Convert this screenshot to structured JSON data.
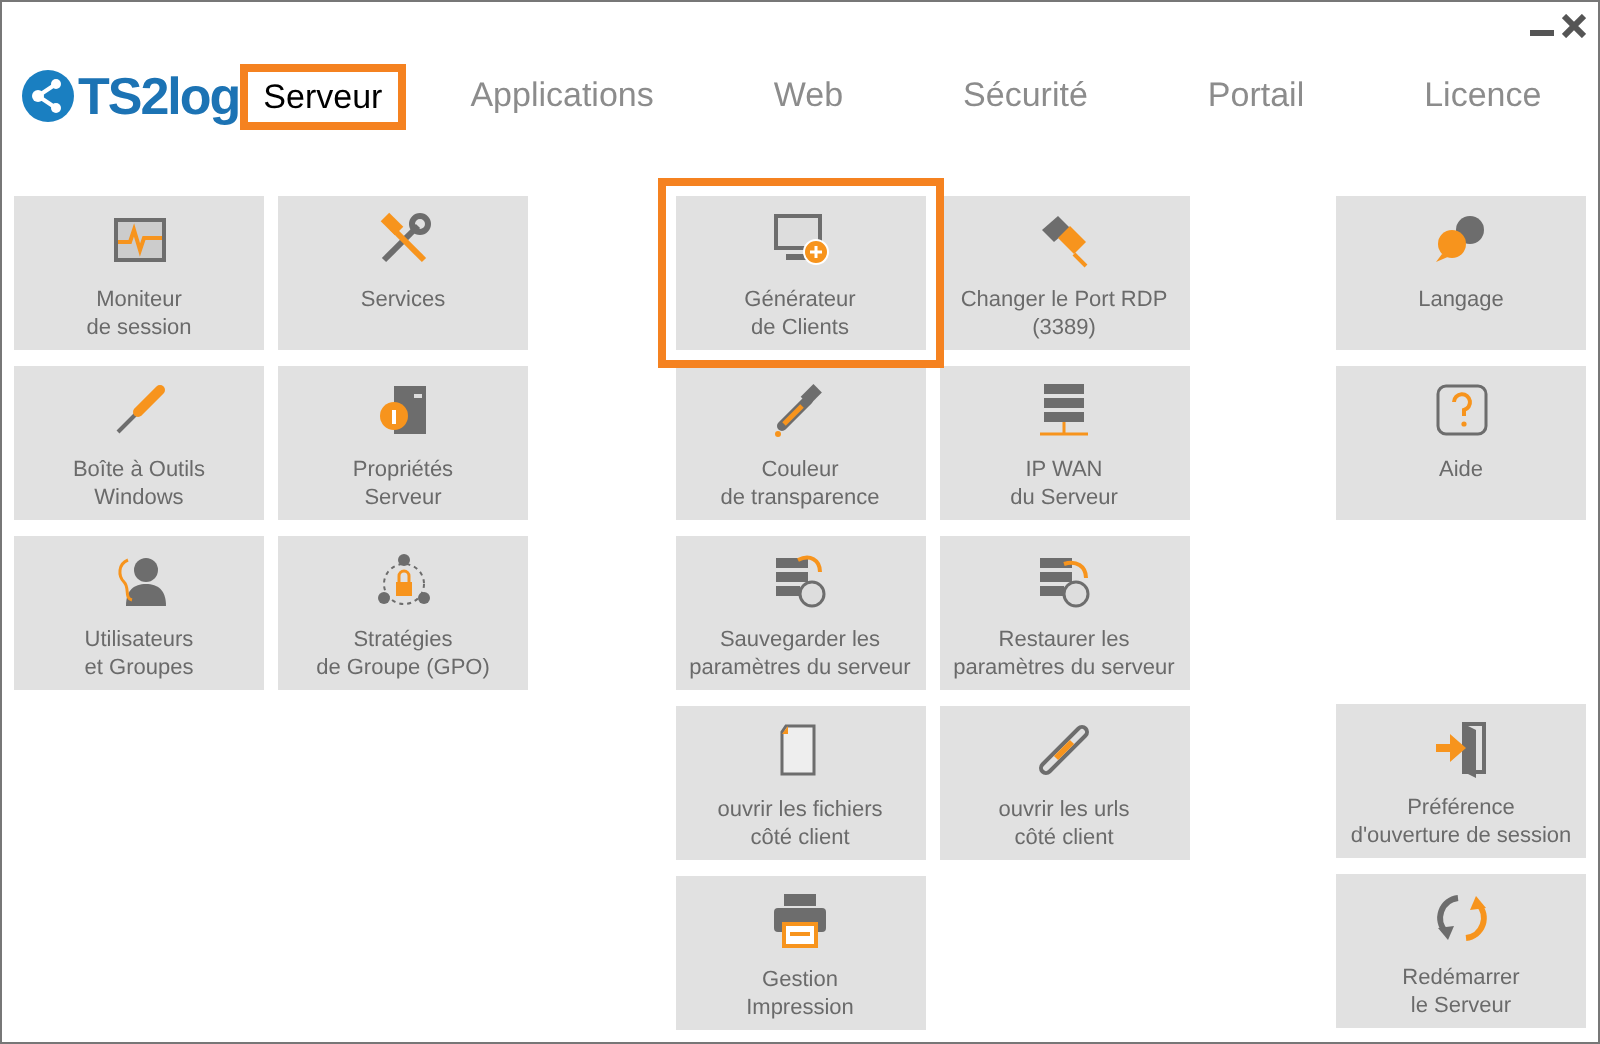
{
  "logo": {
    "text": "TS2log"
  },
  "tabs": [
    {
      "label": "Serveur",
      "selected": true
    },
    {
      "label": "Applications",
      "selected": false
    },
    {
      "label": "Web",
      "selected": false
    },
    {
      "label": "Sécurité",
      "selected": false
    },
    {
      "label": "Portail",
      "selected": false
    },
    {
      "label": "Licence",
      "selected": false
    }
  ],
  "left_tiles": [
    {
      "label": "Moniteur\nde session",
      "selected": false
    },
    {
      "label": "Services",
      "selected": false
    },
    {
      "label": "Boîte à Outils\nWindows",
      "selected": false
    },
    {
      "label": "Propriétés\nServeur",
      "selected": false
    },
    {
      "label": "Utilisateurs\net Groupes",
      "selected": false
    },
    {
      "label": "Stratégies\nde Groupe (GPO)",
      "selected": false
    }
  ],
  "middle_tiles": [
    {
      "label": "Générateur\nde Clients",
      "selected": true
    },
    {
      "label": "Changer le Port RDP\n(3389)",
      "selected": false
    },
    {
      "label": "Couleur\nde transparence",
      "selected": false
    },
    {
      "label": "IP WAN\ndu Serveur",
      "selected": false
    },
    {
      "label": "Sauvegarder les\nparamètres du serveur",
      "selected": false
    },
    {
      "label": "Restaurer les\nparamètres du serveur",
      "selected": false
    },
    {
      "label": "ouvrir les fichiers\ncôté client",
      "selected": false
    },
    {
      "label": "ouvrir les urls\ncôté client",
      "selected": false
    },
    {
      "label": "Gestion\nImpression",
      "selected": false
    }
  ],
  "right_top_tiles": [
    {
      "label": "Langage",
      "selected": false
    },
    {
      "label": "Aide",
      "selected": false
    }
  ],
  "right_bottom_tiles": [
    {
      "label": "Préférence\nd'ouverture de session",
      "selected": false
    },
    {
      "label": "Redémarrer\nle Serveur",
      "selected": false
    }
  ]
}
